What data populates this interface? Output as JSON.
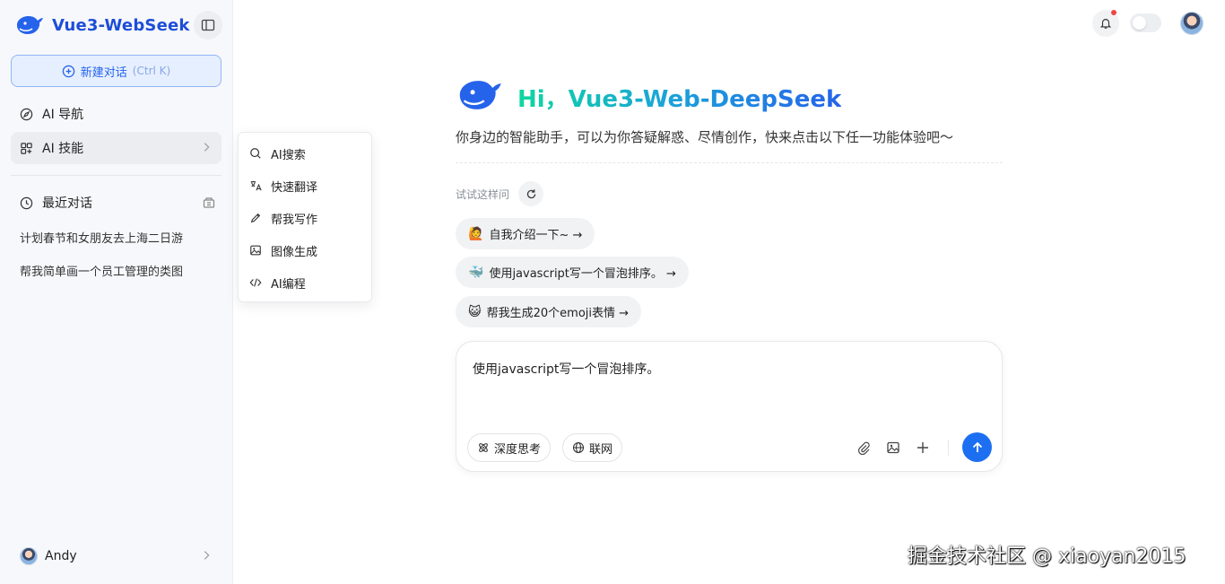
{
  "sidebar": {
    "brand": "Vue3-WebSeek",
    "new_chat": {
      "label": "新建对话",
      "shortcut": "(Ctrl K)"
    },
    "nav": [
      {
        "label": "AI 导航",
        "icon": "compass-icon"
      },
      {
        "label": "AI 技能",
        "icon": "grid-icon",
        "active": true
      }
    ],
    "recent": {
      "title": "最近对话",
      "items": [
        "计划春节和女朋友去上海二日游",
        "帮我简单画一个员工管理的类图"
      ]
    },
    "user": {
      "name": "Andy"
    }
  },
  "skills_menu": {
    "items": [
      {
        "label": "AI搜索",
        "icon": "search-icon"
      },
      {
        "label": "快速翻译",
        "icon": "translate-icon"
      },
      {
        "label": "帮我写作",
        "icon": "pen-icon"
      },
      {
        "label": "图像生成",
        "icon": "image-icon"
      },
      {
        "label": "AI编程",
        "icon": "code-icon"
      }
    ]
  },
  "header": {
    "notification_dot_color": "#ef4444"
  },
  "hero": {
    "title": "Hi，Vue3-Web-DeepSeek",
    "subtitle": "你身边的智能助手，可以为你答疑解惑、尽情创作，快来点击以下任一功能体验吧～"
  },
  "suggestions": {
    "label": "试试这样问",
    "items": [
      {
        "emoji": "🙋",
        "text": "自我介绍一下~ →"
      },
      {
        "emoji": "🐳",
        "text": "使用javascript写一个冒泡排序。 →"
      },
      {
        "emoji": "😺",
        "text": "帮我生成20个emoji表情 →"
      }
    ]
  },
  "composer": {
    "value": "使用javascript写一个冒泡排序。",
    "deep_think": "深度思考",
    "web": "联网"
  },
  "watermark": "掘金技术社区 @ xiaoyan2015",
  "colors": {
    "accent": "#2563eb",
    "send": "#1d6ff2"
  }
}
